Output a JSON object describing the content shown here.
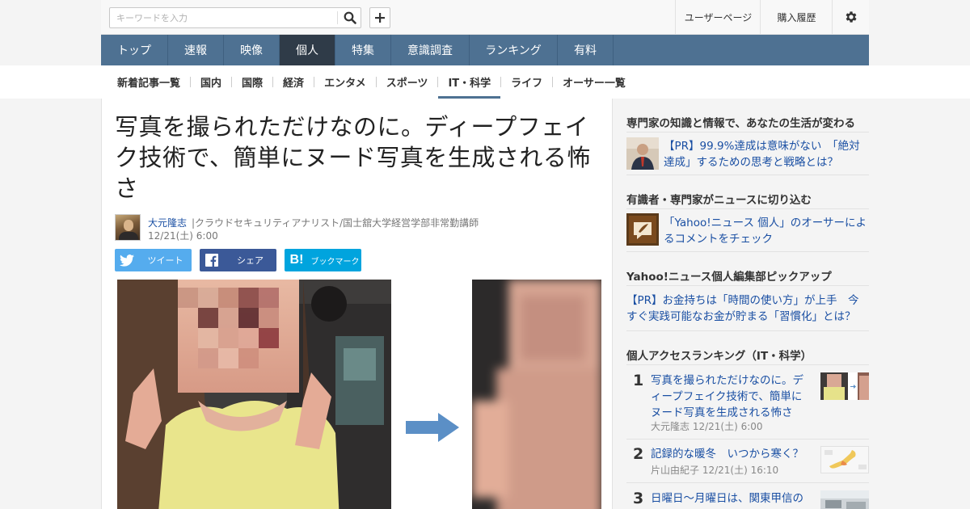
{
  "header": {
    "search_placeholder": "キーワードを入力",
    "user_page": "ユーザーページ",
    "purchase_history": "購入履歴"
  },
  "main_nav": [
    {
      "label": "トップ"
    },
    {
      "label": "速報"
    },
    {
      "label": "映像"
    },
    {
      "label": "個人",
      "active": true
    },
    {
      "label": "特集"
    },
    {
      "label": "意識調査"
    },
    {
      "label": "ランキング"
    },
    {
      "label": "有料"
    }
  ],
  "sub_nav": [
    {
      "label": "新着記事一覧"
    },
    {
      "label": "国内"
    },
    {
      "label": "国際"
    },
    {
      "label": "経済"
    },
    {
      "label": "エンタメ"
    },
    {
      "label": "スポーツ"
    },
    {
      "label": "IT・科学",
      "active": true
    },
    {
      "label": "ライフ"
    },
    {
      "label": "オーサー一覧"
    }
  ],
  "article": {
    "title": "写真を撮られただけなのに。ディープフェイク技術で、簡単にヌード写真を生成される怖さ",
    "author": "大元隆志",
    "author_desc": "|クラウドセキュリティアナリスト/国士舘大学経営学部非常勤講師",
    "date": "12/21(土) 6:00"
  },
  "share": {
    "twitter": "ツイート",
    "facebook": "シェア",
    "hatena": "ブックマーク"
  },
  "sidebar": {
    "section1": {
      "heading": "専門家の知識と情報で、あなたの生活が変わる",
      "link": "【PR】99.9%達成は意味がない　「絶対達成」するための思考と戦略とは？"
    },
    "section2": {
      "heading": "有識者・専門家がニュースに切り込む",
      "link": "「Yahoo!ニュース 個人」のオーサーによるコメントをチェック"
    },
    "section3": {
      "heading": "Yahoo!ニュース個人編集部ピックアップ",
      "link": "【PR】お金持ちは「時間の使い方」が上手　今すぐ実践可能なお金が貯まる「習慣化」とは？"
    },
    "ranking": {
      "heading": "個人アクセスランキング（IT・科学）",
      "items": [
        {
          "rank": "1",
          "title": "写真を撮られただけなのに。ディープフェイク技術で、簡単にヌード写真を生成される怖さ",
          "author": "大元隆志",
          "date": "12/21(土) 6:00"
        },
        {
          "rank": "2",
          "title": "記録的な暖冬　いつから寒く？",
          "author": "片山由紀子",
          "date": "12/21(土) 16:10"
        },
        {
          "rank": "3",
          "title": "日曜日～月曜日は、関東甲信の",
          "author": "",
          "date": ""
        }
      ]
    }
  },
  "colors": {
    "nav_bg": "#4e7192",
    "nav_active": "#2f3b48",
    "link": "#1a4fa3",
    "twitter": "#55acee",
    "facebook": "#3b5998",
    "hatena": "#00a4de"
  }
}
